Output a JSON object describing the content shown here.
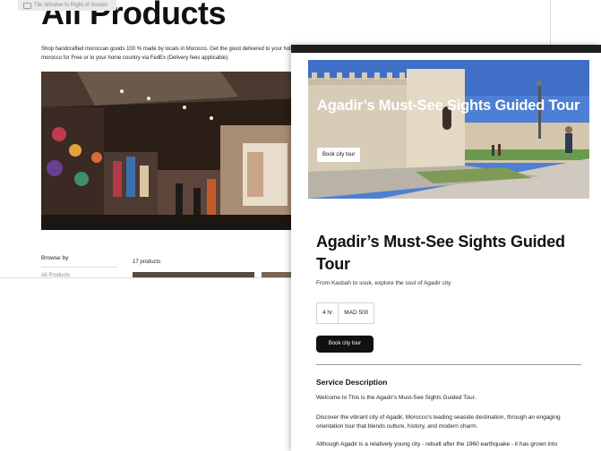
{
  "tooltip": {
    "text": "Tile Window to Right of Screen"
  },
  "store": {
    "title": "All Products",
    "description": "Shop handcrafted moroccan goods 100 % made by locals in Morocco. Get the good delivered to your hotel in morocco for Free or to your home country via FedEx (Delivery fees applicable).",
    "browse_label": "Browse by",
    "browse_first_item": "All Products",
    "product_count": "17 products"
  },
  "tour": {
    "hero_title": "Agadir’s Must-See Sights Guided Tour",
    "hero_button": "Book city tour",
    "title": "Agadir’s Must-See Sights Guided Tour",
    "subtitle": "From Kasbah to souk, explore the soul of Agadir city",
    "duration": "4 hr",
    "price": "MAD 500",
    "book_button": "Book city tour",
    "service_heading": "Service Description",
    "p1": "Welcome to This is the Agadir's Must-See Sights Guided Tour.",
    "p2": "Discover the vibrant city of Agadir, Morocco's leading seaside destination, through an engaging orientation tour that blends culture, history, and modern charm.",
    "p3": "Although Agadir is a relatively young city - rebuilt after the 1960 earthquake - it has grown into"
  },
  "colors": {
    "dark": "#111111",
    "window_bar": "#1e1e1e",
    "sky": "#4d7fd4",
    "divider": "#9a9a9a"
  }
}
